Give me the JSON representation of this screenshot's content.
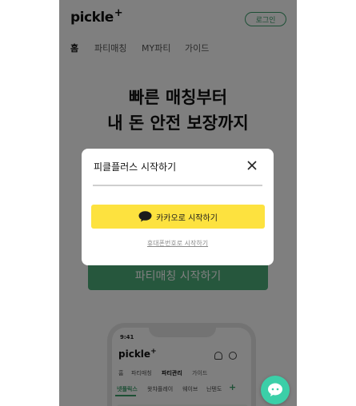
{
  "header": {
    "logo_text": "pickle",
    "logo_plus": "+",
    "login_label": "로그인"
  },
  "nav": {
    "items": [
      {
        "label": "홈",
        "active": true
      },
      {
        "label": "파티매칭",
        "active": false
      },
      {
        "label": "MY파티",
        "active": false
      },
      {
        "label": "가이드",
        "active": false
      }
    ]
  },
  "hero": {
    "title_line1": "빠른 매칭부터",
    "title_line2": "내 돈 안전 보장까지",
    "cta_label": "파티매칭 시작하기"
  },
  "phone_mock": {
    "time": "9:41",
    "logo_text": "pickle",
    "logo_plus": "+",
    "nav": [
      "홈",
      "파티매칭",
      "파티관리",
      "가이드"
    ],
    "tabs": [
      "넷플릭스",
      "왓챠플레이",
      "웨이브",
      "닌텐도"
    ],
    "add_label": "+"
  },
  "modal": {
    "title": "피클플러스 시작하기",
    "kakao_label": "카카오로 시작하기",
    "phone_link": "휴대폰번호로 시작하기"
  },
  "colors": {
    "brand_green": "#4caf7a",
    "kakao_yellow": "#fde23f",
    "chat_fab": "#3bcfa8"
  },
  "icons": {
    "close": "close-icon",
    "kakao": "kakao-talk-icon",
    "chat": "chat-bubble-icon",
    "bell": "bell-icon",
    "user": "user-icon"
  }
}
